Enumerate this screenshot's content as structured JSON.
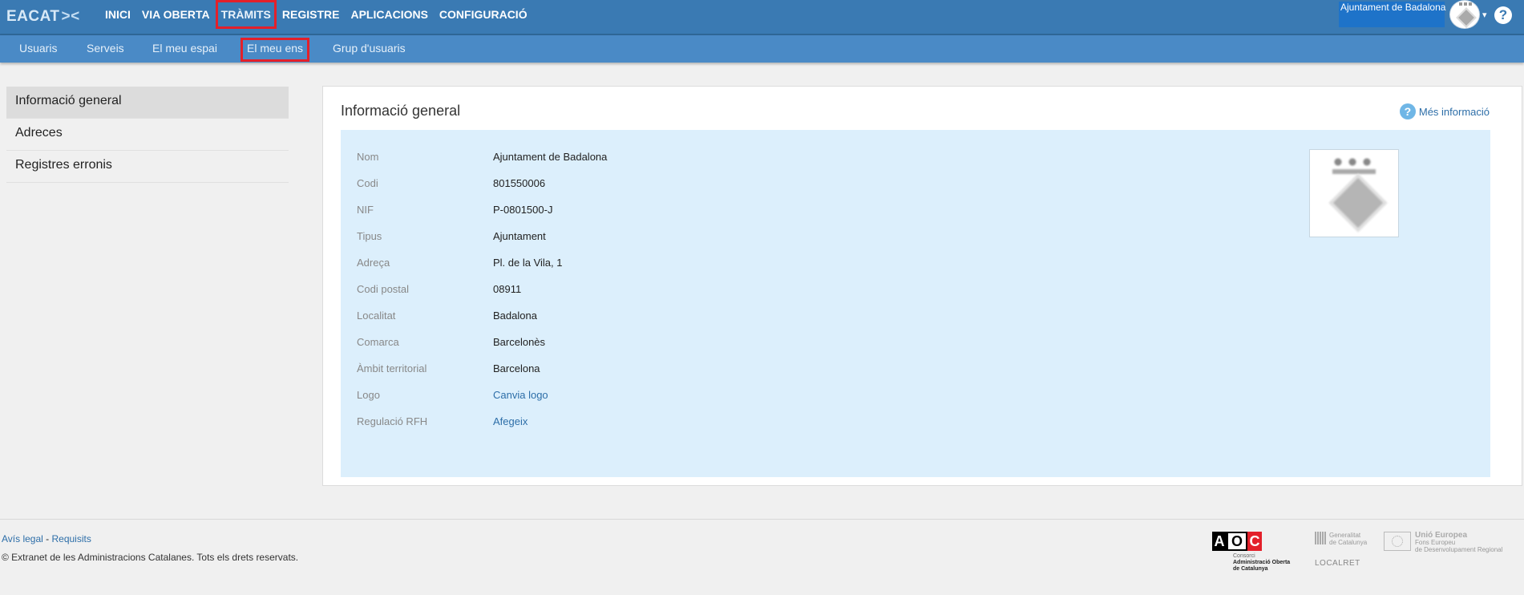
{
  "topbar": {
    "brand": "EACAT",
    "brand_mark": "><",
    "nav": [
      {
        "label": "INICI",
        "highlight": false
      },
      {
        "label": "VIA OBERTA",
        "highlight": false
      },
      {
        "label": "TRÀMITS",
        "highlight": true
      },
      {
        "label": "REGISTRE",
        "highlight": false
      },
      {
        "label": "APLICACIONS",
        "highlight": false
      },
      {
        "label": "CONFIGURACIÓ",
        "highlight": false
      }
    ],
    "org_name": "Ajuntament de Badalona",
    "caret": "▾",
    "help": "?"
  },
  "subnav": [
    {
      "label": "Usuaris",
      "highlight": false
    },
    {
      "label": "Serveis",
      "highlight": false
    },
    {
      "label": "El meu espai",
      "highlight": false
    },
    {
      "label": "El meu ens",
      "highlight": true
    },
    {
      "label": "Grup d'usuaris",
      "highlight": false
    }
  ],
  "leftmenu": [
    {
      "label": "Informació general",
      "active": true
    },
    {
      "label": "Adreces",
      "active": false
    },
    {
      "label": "Registres erronis",
      "active": false
    }
  ],
  "panel": {
    "title": "Informació general",
    "more_info": "Més informació",
    "rows": [
      {
        "label": "Nom",
        "value": "Ajuntament de Badalona",
        "link": false
      },
      {
        "label": "Codi",
        "value": "801550006",
        "link": false
      },
      {
        "label": "NIF",
        "value": "P-0801500-J",
        "link": false
      },
      {
        "label": "Tipus",
        "value": "Ajuntament",
        "link": false
      },
      {
        "label": "Adreça",
        "value": "Pl. de la Vila, 1",
        "link": false
      },
      {
        "label": "Codi postal",
        "value": "08911",
        "link": false
      },
      {
        "label": "Localitat",
        "value": "Badalona",
        "link": false
      },
      {
        "label": "Comarca",
        "value": "Barcelonès",
        "link": false
      },
      {
        "label": "Àmbit territorial",
        "value": "Barcelona",
        "link": false
      },
      {
        "label": "Logo",
        "value": "Canvia logo",
        "link": true
      },
      {
        "label": "Regulació RFH",
        "value": "Afegeix",
        "link": true
      }
    ]
  },
  "footer": {
    "legal": "Avís legal",
    "sep": " - ",
    "requirements": "Requisits",
    "copyright": "© Extranet de les Administracions Catalanes. Tots els drets reservats.",
    "aoc": {
      "a": "A",
      "o": "O",
      "c": "C",
      "line1": "Consorci",
      "line2": "Administració Oberta",
      "line3": "de Catalunya"
    },
    "gencat": {
      "line1": "Generalitat",
      "line2": "de Catalunya"
    },
    "ue": {
      "line1": "Unió Europea",
      "line2": "Fons Europeu",
      "line3": "de Desenvolupament Regional"
    },
    "localret": "LOCALRET"
  }
}
